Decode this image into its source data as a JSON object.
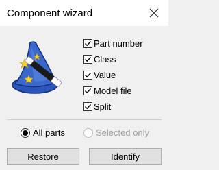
{
  "window": {
    "title": "Component wizard",
    "close_icon": "close-icon"
  },
  "wizard": {
    "icon": "wizard-hat-with-wand-icon"
  },
  "checks": [
    {
      "label": "Part number",
      "checked": true
    },
    {
      "label": "Class",
      "checked": true
    },
    {
      "label": "Value",
      "checked": true
    },
    {
      "label": "Model file",
      "checked": true
    },
    {
      "label": "Split",
      "checked": true
    }
  ],
  "scope": {
    "all_parts": {
      "label": "All parts",
      "selected": true,
      "enabled": true
    },
    "selected_only": {
      "label": "Selected only",
      "selected": false,
      "enabled": false
    }
  },
  "buttons": {
    "restore": "Restore",
    "identify": "Identify"
  },
  "colors": {
    "dialog_bg": "#f0f0f0",
    "titlebar_bg": "#ffffff",
    "hat_blue": "#2b55b8",
    "star_yellow": "#f5d530"
  }
}
